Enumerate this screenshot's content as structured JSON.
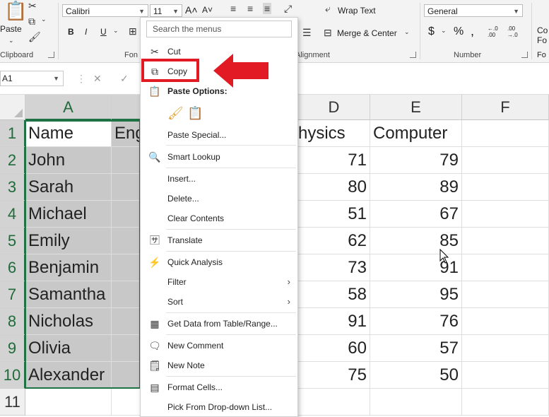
{
  "ribbon": {
    "paste_label": "Paste",
    "font_name": "Calibri",
    "font_size": "11",
    "wrap_text": "Wrap Text",
    "merge_center": "Merge & Center",
    "number_format": "General",
    "clipboard_group": "Clipboard",
    "font_group_partial": "Fon",
    "alignment_group": "Alignment",
    "number_group": "Number",
    "currency_symbol": "$",
    "percent_symbol": "%",
    "inc_decimal": "←.0 .00",
    "dec_decimal": ".00 →.0",
    "bold": "B",
    "italic": "I",
    "underline": "U",
    "cond_partial_1": "Co",
    "cond_partial_2": "Fo",
    "format_partial": "Fo"
  },
  "formula_bar": {
    "name_box": "A1"
  },
  "sheet": {
    "columns": [
      "A",
      "",
      "D",
      "E",
      "F"
    ],
    "rows": [
      "1",
      "2",
      "3",
      "4",
      "5",
      "6",
      "7",
      "8",
      "9",
      "10",
      "11"
    ],
    "b1_partial": "Eng",
    "c1_partial": "hysics",
    "e1": "Computer",
    "names": [
      "Name",
      "John",
      "Sarah",
      "Michael",
      "Emily",
      "Benjamin",
      "Samantha",
      "Nicholas",
      "Olivia",
      "Alexander"
    ],
    "physics": [
      "71",
      "80",
      "51",
      "62",
      "73",
      "58",
      "91",
      "60",
      "75"
    ],
    "computer": [
      "79",
      "89",
      "67",
      "85",
      "91",
      "95",
      "76",
      "57",
      "50"
    ]
  },
  "menu": {
    "search_placeholder": "Search the menus",
    "items": {
      "cut": "Cut",
      "copy": "Copy",
      "paste_options": "Paste Options:",
      "paste_special": "Paste Special...",
      "smart_lookup": "Smart Lookup",
      "insert": "Insert...",
      "delete": "Delete...",
      "clear_contents": "Clear Contents",
      "translate": "Translate",
      "quick_analysis": "Quick Analysis",
      "filter": "Filter",
      "sort": "Sort",
      "get_data": "Get Data from Table/Range...",
      "new_comment": "New Comment",
      "new_note": "New Note",
      "format_cells": "Format Cells...",
      "pick_dropdown": "Pick From Drop-down List..."
    }
  },
  "colors": {
    "excel_green": "#1f7244",
    "highlight_red": "#e21a23",
    "selected_fill": "#c8c8c8"
  }
}
